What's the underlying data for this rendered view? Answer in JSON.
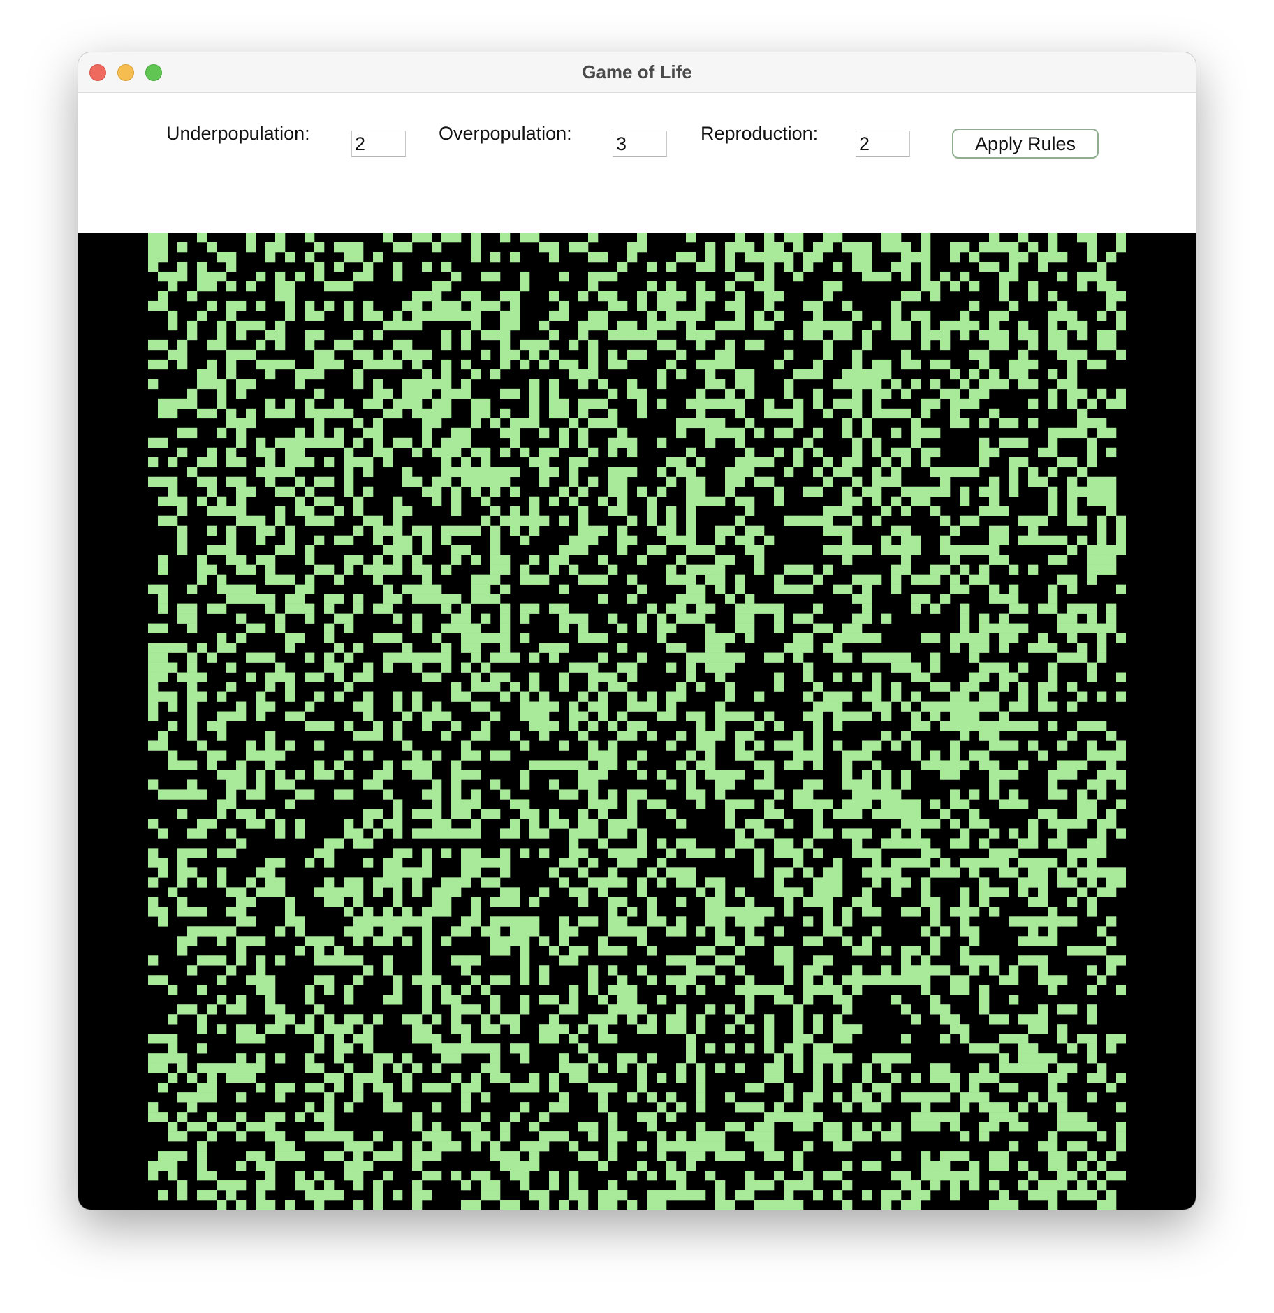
{
  "window": {
    "title": "Game of Life"
  },
  "rules": {
    "underpopulation_label": "Underpopulation:",
    "underpopulation_value": "2",
    "overpopulation_label": "Overpopulation:",
    "overpopulation_value": "3",
    "reproduction_label": "Reproduction:",
    "reproduction_value": "2",
    "apply_label": "Apply Rules"
  },
  "board": {
    "cell_color": "#a8e99a",
    "background_color": "#000000",
    "columns": 100,
    "rows": 100,
    "density": 0.4,
    "seed": 12345
  },
  "colors": {
    "close": "#ee6a5e",
    "minimize": "#f5bd4f",
    "maximize": "#61c554"
  }
}
